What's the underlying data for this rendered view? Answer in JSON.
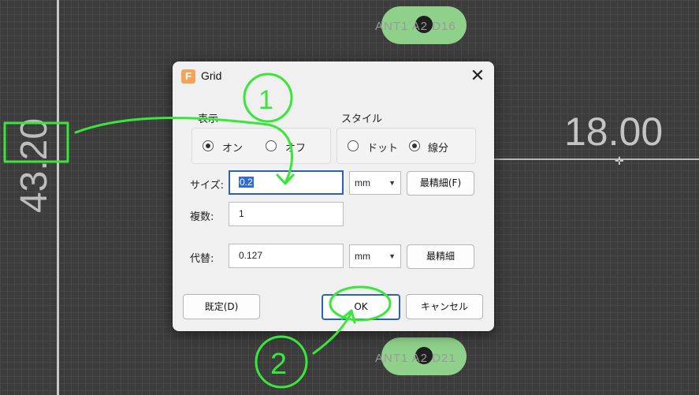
{
  "canvas": {
    "pad_top_label": "ANT1 A2 D16",
    "pad_bottom_label": "ANT1 A2 D21",
    "dimension_vertical": "43.20",
    "dimension_horizontal": "18.00"
  },
  "dialog": {
    "title": "Grid",
    "icon_letter": "F",
    "display": {
      "label": "表示",
      "on_label": "オン",
      "off_label": "オフ",
      "selected": "on"
    },
    "style": {
      "label": "スタイル",
      "dot_label": "ドット",
      "line_label": "線分",
      "selected": "line"
    },
    "size": {
      "label": "サイズ:",
      "value": "0.2",
      "unit": "mm",
      "finest_button": "最精細(F)"
    },
    "multiple": {
      "label": "複数:",
      "value": "1"
    },
    "alt": {
      "label": "代替:",
      "value": "0.127",
      "unit": "mm",
      "finest_button": "最精細"
    },
    "buttons": {
      "default": "既定(D)",
      "ok": "OK",
      "cancel": "キャンセル"
    }
  },
  "annotation": {
    "color": "#39e639",
    "step1": "1",
    "step2": "2"
  }
}
